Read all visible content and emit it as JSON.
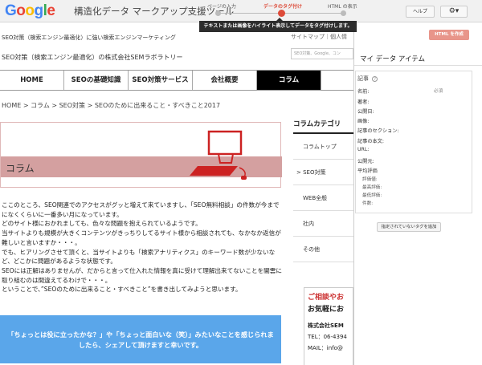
{
  "app": {
    "logo": "Google",
    "title": "構造化データ マークアップ支援ツール",
    "help": "ヘルプ",
    "gear_caret": "▾"
  },
  "steps": [
    {
      "label": "ページの入力",
      "active": false
    },
    {
      "label": "データのタグ付け",
      "active": true
    },
    {
      "label": "HTML の表示",
      "active": false
    }
  ],
  "tooltip": "テキストまたは画像をハイライト表示してデータをタグ付けします。",
  "site": {
    "tagline": "SEO対策（検索エンジン最適化）に強い検索エンジンマーケティング",
    "company": "SEO対策（検索エンジン最適化）の株式会社SEMラボラトリー",
    "toplinks": "サイトマップ｜個人情",
    "search_placeholder": "SEO対策、Google、コン",
    "nav": [
      "HOME",
      "SEOの基礎知識",
      "SEO対策サービス",
      "会社概要",
      "コラム"
    ],
    "nav_active": 4,
    "breadcrumb": "HOME > コラム > SEO対策 > SEOのために出来ること・すべきこと2017",
    "hero_label": "コラム",
    "body": [
      "ここのところ、SEO関連でのアクセスがグッと増えて来ていますし、「SEO無料相談」の件数が今までになくくらいに一番多い月になっています。",
      "どのサイト様におかれましても、色々な問題を抱えられているようです。",
      "当サイトよりも規模が大きくコンテンツがきっちりしてるサイト様から相談されても、なかなか返信が難しいと言いますか・・・。",
      "でも、ヒアリングさせて頂くと、当サイトよりも「検索アナリティクス」のキーワード数が少ないなど、どこかに問題があるような状態です。",
      "SEOには正解はありませんが、だからと言って仕入れた情報を真に受けて理解出来てないことを闇雲に取り組むのは間違えてるわけで・・・。",
      "ということで、”SEOのために出来ること・すべきこと”を書き出してみようと思います。"
    ],
    "banner_line1": "「ちょっとは役に立ったかな？」や「ちょっと面白いな（笑）」みたいなことを感じられま",
    "banner_line2": "したら、シェアして頂けますと幸いです。",
    "sidebar_title": "コラムカテゴリ",
    "sidebar_items": [
      "コラムトップ",
      "> SEO対策",
      "WEB全般",
      "社内",
      "その他"
    ],
    "contact": {
      "line1": "ご相談やお",
      "line2": "お気軽にお",
      "company": "株式会社SEM",
      "tel": "TEL：06-4394",
      "mail": "MAIL：info@"
    }
  },
  "panel": {
    "create_button": "HTML を作成",
    "title": "マイ データ アイテム",
    "header": "記事",
    "required": "必須",
    "fields": [
      "名前:",
      "著者:",
      "公開日:",
      "画像:",
      "記事のセクション:",
      "記事の本文:",
      "URL:",
      "公開元:",
      "平均評価"
    ],
    "sub_fields": [
      "評価値:",
      "最高評価:",
      "最低評価:",
      "件数:"
    ],
    "add_button": "指定されていないタグを追加"
  }
}
